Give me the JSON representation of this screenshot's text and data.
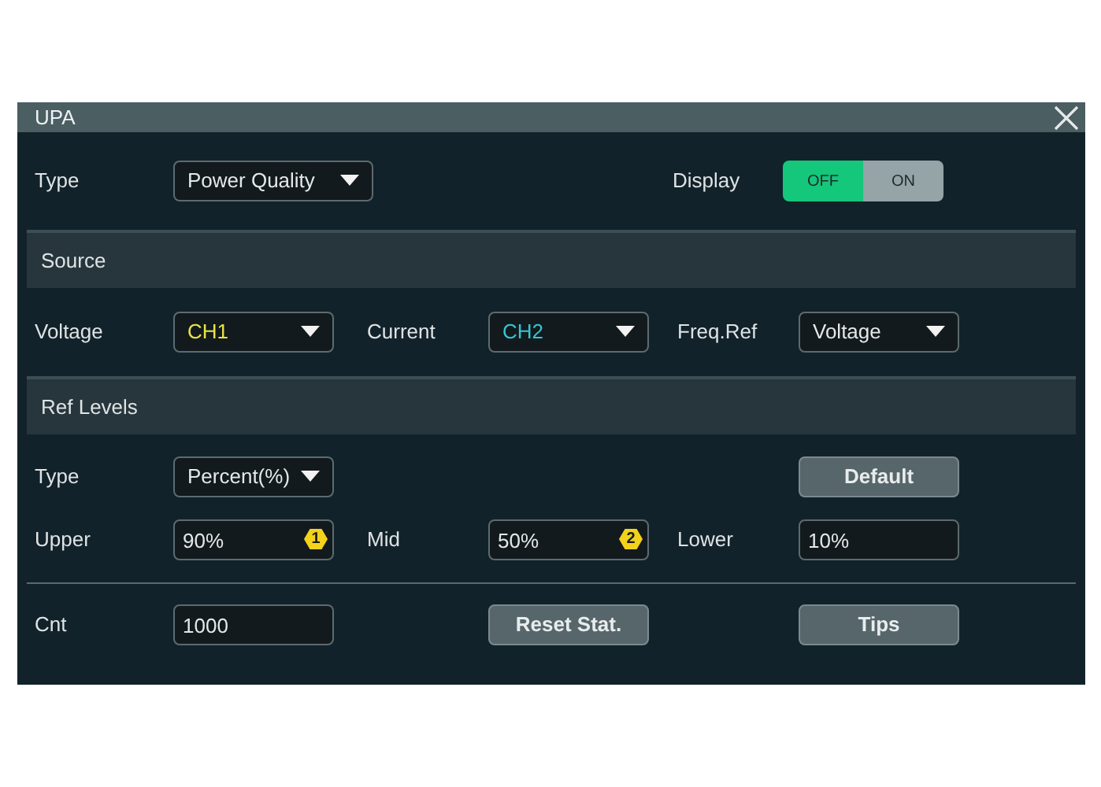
{
  "window": {
    "title": "UPA"
  },
  "settings": {
    "type": {
      "label": "Type",
      "value": "Power Quality"
    },
    "display": {
      "label": "Display",
      "options": [
        {
          "label": "OFF",
          "selected": true
        },
        {
          "label": "ON",
          "selected": false
        }
      ]
    }
  },
  "source": {
    "title": "Source",
    "fields": [
      {
        "label": "Voltage",
        "value": "CH1",
        "color": "#e8e24a"
      },
      {
        "label": "Current",
        "value": "CH2",
        "color": "#33c6d2"
      },
      {
        "label": "Freq.Ref",
        "value": "Voltage",
        "color": "#e5e7e8"
      }
    ]
  },
  "ref_levels": {
    "title": "Ref Levels",
    "type": {
      "label": "Type",
      "value": "Percent(%)"
    },
    "default_button": "Default",
    "levels": [
      {
        "label": "Upper",
        "value": "90%",
        "badge": "1"
      },
      {
        "label": "Mid",
        "value": "50%",
        "badge": "2"
      },
      {
        "label": "Lower",
        "value": "10%"
      }
    ]
  },
  "cnt": {
    "label": "Cnt",
    "value": "1000"
  },
  "buttons": [
    "Reset Stat.",
    "Tips"
  ]
}
